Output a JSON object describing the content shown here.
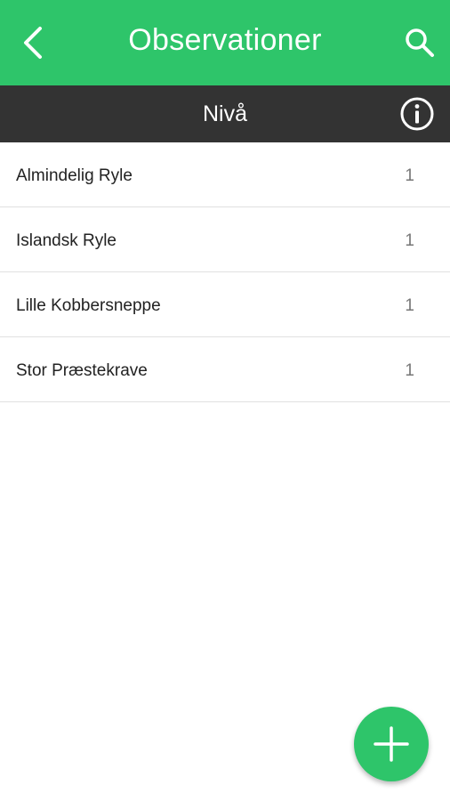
{
  "header": {
    "title": "Observationer",
    "back_icon": "chevron-left-icon",
    "search_icon": "search-icon"
  },
  "subheader": {
    "title": "Nivå",
    "info_icon": "info-icon"
  },
  "observations": [
    {
      "name": "Almindelig Ryle",
      "count": "1"
    },
    {
      "name": "Islandsk Ryle",
      "count": "1"
    },
    {
      "name": "Lille Kobbersneppe",
      "count": "1"
    },
    {
      "name": "Stor Præstekrave",
      "count": "1"
    }
  ],
  "fab": {
    "icon": "plus-icon"
  },
  "colors": {
    "primary": "#2ec56a",
    "subheader": "#333333",
    "text": "#222222",
    "count": "#777777",
    "divider": "#e0e0e0"
  }
}
